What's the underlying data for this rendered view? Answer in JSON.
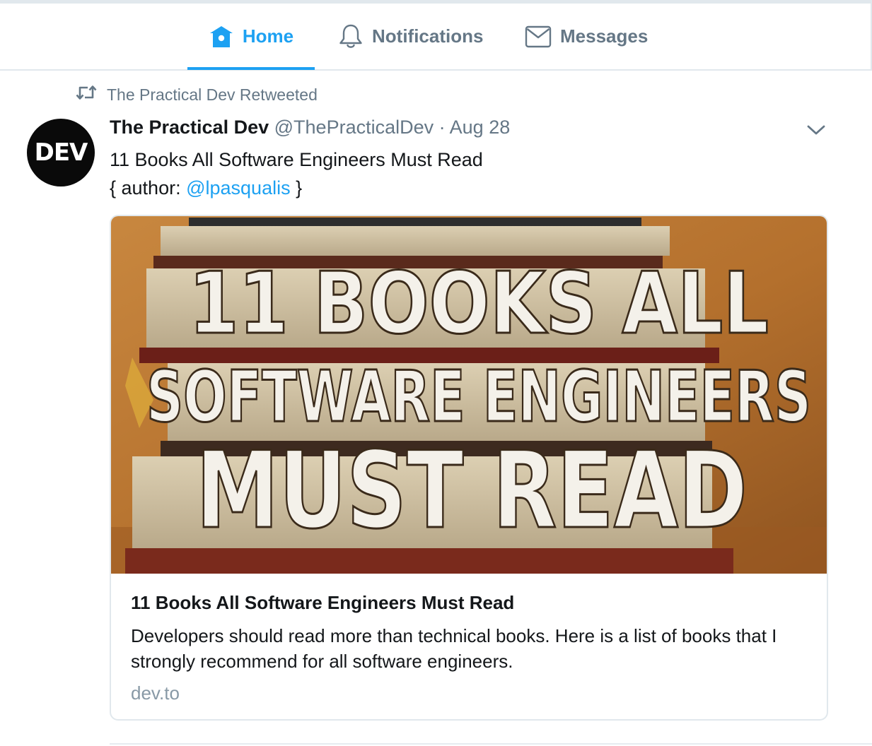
{
  "nav": {
    "tabs": [
      {
        "label": "Home",
        "icon": "home-icon",
        "active": true
      },
      {
        "label": "Notifications",
        "icon": "bell-icon",
        "active": false
      },
      {
        "label": "Messages",
        "icon": "envelope-icon",
        "active": false
      }
    ]
  },
  "tweet": {
    "retweet_text": "The Practical Dev Retweeted",
    "avatar_text": "DEV",
    "author_name": "The Practical Dev",
    "handle": "@ThePracticalDev",
    "separator": "·",
    "date": "Aug 28",
    "text_line1": "11 Books All Software Engineers Must Read",
    "text_line2_prefix": "{ author: ",
    "text_line2_mention": "@lpasqualis",
    "text_line2_suffix": " }",
    "card": {
      "image_text_line1": "11 BOOKS ALL",
      "image_text_line2": "SOFTWARE ENGINEERS",
      "image_text_line3": "MUST READ",
      "title": "11 Books All Software Engineers Must Read",
      "description": "Developers should read more than technical books. Here is a list of books that I strongly recommend for all software engineers.",
      "domain": "dev.to"
    }
  },
  "colors": {
    "accent": "#1da1f2",
    "muted": "#657786",
    "text": "#14171a",
    "border": "#e1e8ed"
  }
}
